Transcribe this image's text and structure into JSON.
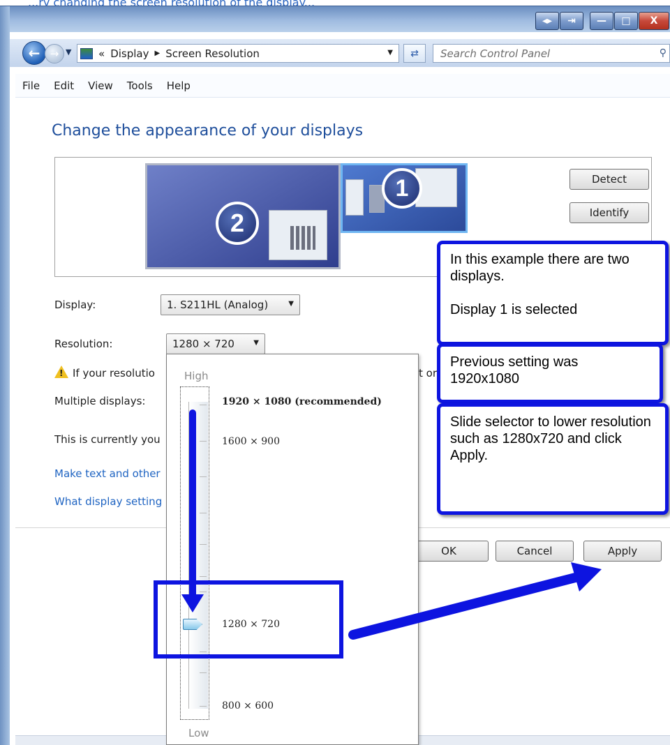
{
  "caption": "...ry changing the screen resolution of the display...",
  "window": {
    "buttons": [
      "◂▸",
      "⇥",
      "—",
      "□",
      "X"
    ]
  },
  "address": {
    "overflow": "«",
    "crumbs": [
      "Display",
      "Screen Resolution"
    ],
    "search_placeholder": "Search Control Panel"
  },
  "menu": [
    "File",
    "Edit",
    "View",
    "Tools",
    "Help"
  ],
  "page_title": "Change the appearance of your displays",
  "monitors": {
    "badge2": "2",
    "badge1": "1",
    "detect_label": "Detect",
    "identify_label": "Identify"
  },
  "form": {
    "display_label": "Display:",
    "display_value": "1. S211HL (Analog)",
    "resolution_label": "Resolution:",
    "resolution_value": "1280 × 720",
    "warning_text": "If your resolutio",
    "warning_tail": "t or",
    "multiple_label": "Multiple displays:",
    "current_text": "This is currently you",
    "link1": "Make text and other",
    "link2": "What display setting"
  },
  "dialog_buttons": {
    "ok": "OK",
    "cancel": "Cancel",
    "apply": "Apply"
  },
  "slider": {
    "high_label": "High",
    "low_label": "Low",
    "options": [
      "1920 × 1080 (recommended)",
      "1600 × 900",
      "1280 × 720",
      "800 × 600"
    ],
    "selected": "1280 × 720"
  },
  "annotations": {
    "note1_line1": "In this example there are two displays.",
    "note1_line2": "Display 1 is selected",
    "note2": "Previous setting was 1920x1080",
    "note3": "Slide selector to lower resolution such as 1280x720 and click Apply."
  },
  "colors": {
    "annotation": "#0d14e0",
    "title": "#1e4e9b",
    "link": "#1f64c2"
  }
}
